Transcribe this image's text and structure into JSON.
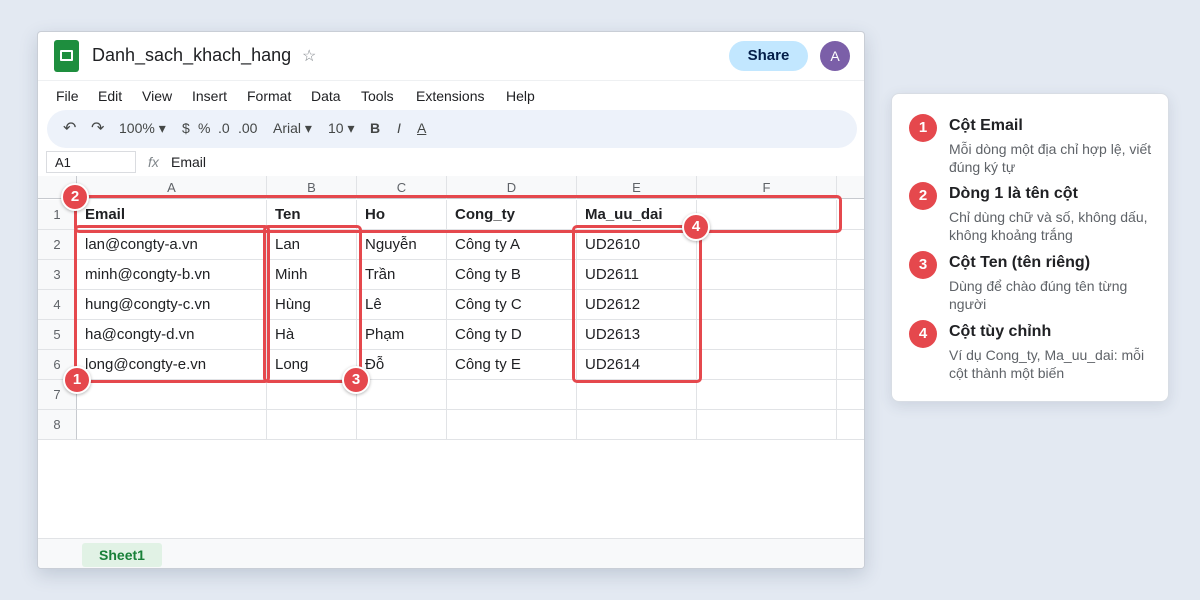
{
  "title_bar": {
    "doc_title": "Danh_sach_khach_hang",
    "star_icon": "☆",
    "share_label": "Share",
    "avatar_initial": "A"
  },
  "menu": [
    "File",
    "Edit",
    "View",
    "Insert",
    "Format",
    "Data",
    "Tools",
    "Extensions",
    "Help"
  ],
  "toolbar": {
    "undo": "↶",
    "redo": "↷",
    "zoom": "100% ▾",
    "currency": "$",
    "percent": "%",
    "dec_decrease": ".0",
    "dec_increase": ".00",
    "font": "Arial ▾",
    "font_size": "10 ▾",
    "bold": "B",
    "italic": "I",
    "text_color": "A"
  },
  "formula_bar": {
    "cell_ref": "A1",
    "fx_label": "fx",
    "value": "Email"
  },
  "columns": [
    "A",
    "B",
    "C",
    "D",
    "E",
    "F"
  ],
  "row_numbers": [
    "1",
    "2",
    "3",
    "4",
    "5",
    "6",
    "7",
    "8"
  ],
  "rows": [
    [
      "Email",
      "Ten",
      "Ho",
      "Cong_ty",
      "Ma_uu_dai",
      ""
    ],
    [
      "lan@congty-a.vn",
      "Lan",
      "Nguyễn",
      "Công ty A",
      "UD2610",
      ""
    ],
    [
      "minh@congty-b.vn",
      "Minh",
      "Trần",
      "Công ty B",
      "UD2611",
      ""
    ],
    [
      "hung@congty-c.vn",
      "Hùng",
      "Lê",
      "Công ty C",
      "UD2612",
      ""
    ],
    [
      "ha@congty-d.vn",
      "Hà",
      "Phạm",
      "Công ty D",
      "UD2613",
      ""
    ],
    [
      "long@congty-e.vn",
      "Long",
      "Đỗ",
      "Công ty E",
      "UD2614",
      ""
    ],
    [
      "",
      "",
      "",
      "",
      "",
      ""
    ],
    [
      "",
      "",
      "",
      "",
      "",
      ""
    ]
  ],
  "sheet_tab": "Sheet1",
  "markers": [
    "1",
    "2",
    "3",
    "4"
  ],
  "legend": [
    {
      "num": "1",
      "title": "Cột Email",
      "desc": "Mỗi dòng một địa chỉ hợp lệ, viết đúng ký tự"
    },
    {
      "num": "2",
      "title": "Dòng 1 là tên cột",
      "desc": "Chỉ dùng chữ và số, không dấu, không khoảng trắng"
    },
    {
      "num": "3",
      "title": "Cột Ten (tên riêng)",
      "desc": "Dùng để chào đúng tên từng người"
    },
    {
      "num": "4",
      "title": "Cột tùy chỉnh",
      "desc": "Ví dụ Cong_ty, Ma_uu_dai: mỗi cột thành một biến"
    }
  ],
  "colors": {
    "accent_red": "#e5484d",
    "sheets_green": "#1e8e3e",
    "share_blue": "#c2e7ff",
    "avatar_purple": "#7b5fa8"
  }
}
